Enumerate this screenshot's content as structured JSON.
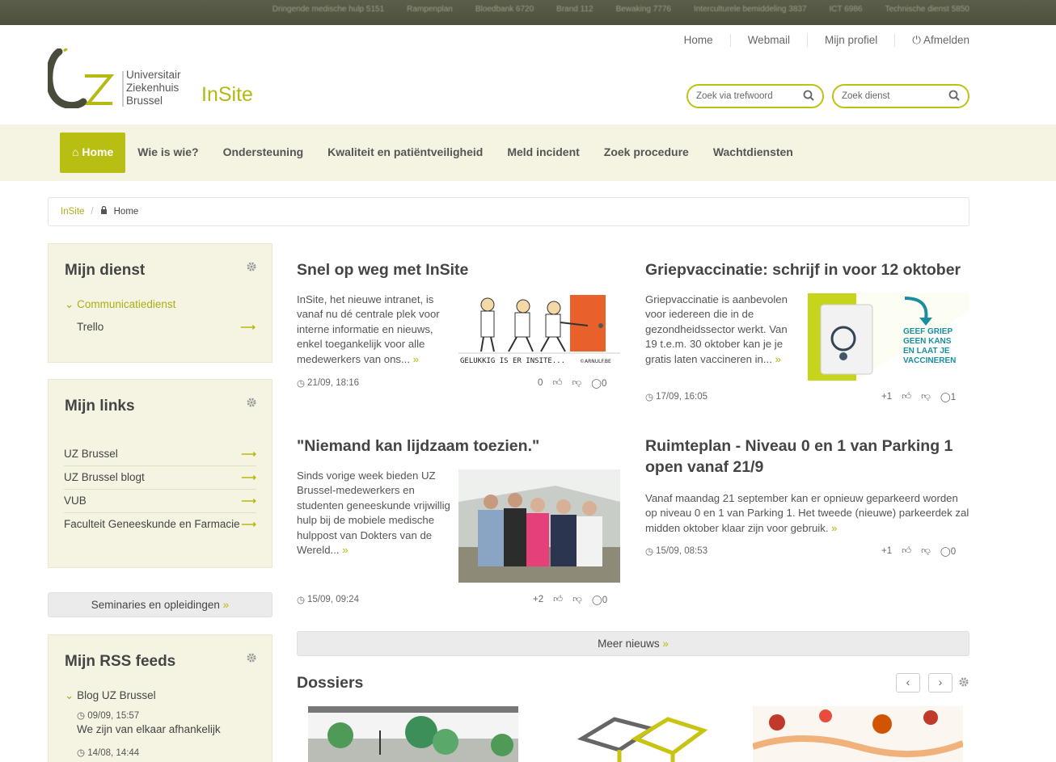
{
  "topbar": {
    "phones": [
      "Dringende medische hulp  5151",
      "Rampenplan",
      "Bloedbank  6720",
      "Brand  112",
      "Bewaking  7776",
      "Interculturele bemiddeling  3837",
      "ICT  6986",
      "Technische dienst  5850"
    ]
  },
  "header": {
    "links": [
      "Home",
      "Webmail",
      "Mijn profiel",
      "Afmelden"
    ],
    "logo_lines": [
      "Universitair",
      "Ziekenhuis",
      "Brussel"
    ],
    "logo_mark": "UZ",
    "site_title": "InSite",
    "search1_placeholder": "Zoek via trefwoord",
    "search2_placeholder": "Zoek dienst"
  },
  "nav": {
    "items": [
      "Home",
      "Wie is wie?",
      "Ondersteuning",
      "Kwaliteit en patiëntveiligheid",
      "Meld incident",
      "Zoek procedure",
      "Wachtdiensten"
    ]
  },
  "breadcrumb": {
    "root": "InSite",
    "sep": "/",
    "current": "Home"
  },
  "sidebar": {
    "mijn_dienst": {
      "title": "Mijn dienst",
      "dienst": "Communicatiedienst",
      "item": "Trello"
    },
    "mijn_links": {
      "title": "Mijn links",
      "items": [
        "UZ Brussel",
        "UZ Brussel blogt",
        "VUB",
        "Faculteit Geneeskunde en Farmacie"
      ]
    },
    "seminaries": "Seminaries en opleidingen",
    "rss": {
      "title": "Mijn RSS feeds",
      "feed": "Blog UZ Brussel",
      "entries": [
        {
          "date": "09/09, 15:57",
          "title": "We zijn van elkaar afhankelijk"
        },
        {
          "date": "14/08, 14:44"
        }
      ]
    }
  },
  "news": [
    {
      "title": "Snel op weg met InSite",
      "text": "InSite, het nieuwe intranet, is vanaf nu dé centrale plek voor interne informatie en nieuws, enkel toegankelijk voor alle medewerkers van ons...",
      "date": "21/09, 18:16",
      "likes": "0",
      "comments": "0",
      "cartoon_caption": "GELUKKIG IS ER INSITE...",
      "cartoon_credit": "©ARNULF.BE"
    },
    {
      "title": "Griepvaccinatie: schrijf in voor 12 oktober",
      "text": "Griepvaccinatie is aanbevolen voor iedereen die in de gezondheidssector werkt. Van 19 t.e.m. 30 oktober kan je je gratis laten vaccineren in...",
      "date": "17/09, 16:05",
      "likes": "+1",
      "comments": "1",
      "banner_lines": [
        "GEEF GRIEP",
        "GEEN KANS",
        "EN LAAT JE",
        "VACCINEREN"
      ]
    },
    {
      "title": "\"Niemand kan lijdzaam toezien.\"",
      "text": "Sinds vorige week bieden UZ Brussel-medewerkers en studenten geneeskunde vrijwillig hulp bij de mobiele medische hulppost van Dokters van de Wereld...",
      "date": "15/09, 09:24",
      "likes": "+2",
      "comments": "0"
    },
    {
      "title": "Ruimteplan - Niveau 0 en 1 van Parking 1 open vanaf 21/9",
      "text": "Vanaf maandag 21 september kan er opnieuw geparkeerd worden op niveau 0 en 1 van Parking 1. Het tweede (nieuwe) parkeerdek zal midden oktober klaar zijn voor gebruik.",
      "date": "15/09, 08:53",
      "likes": "+1",
      "comments": "0"
    }
  ],
  "meer_nieuws": "Meer nieuws",
  "dossiers": {
    "title": "Dossiers"
  },
  "colors": {
    "accent": "#b9be12",
    "nav_bg": "#f5f4e2",
    "topbar": "#53563f"
  }
}
